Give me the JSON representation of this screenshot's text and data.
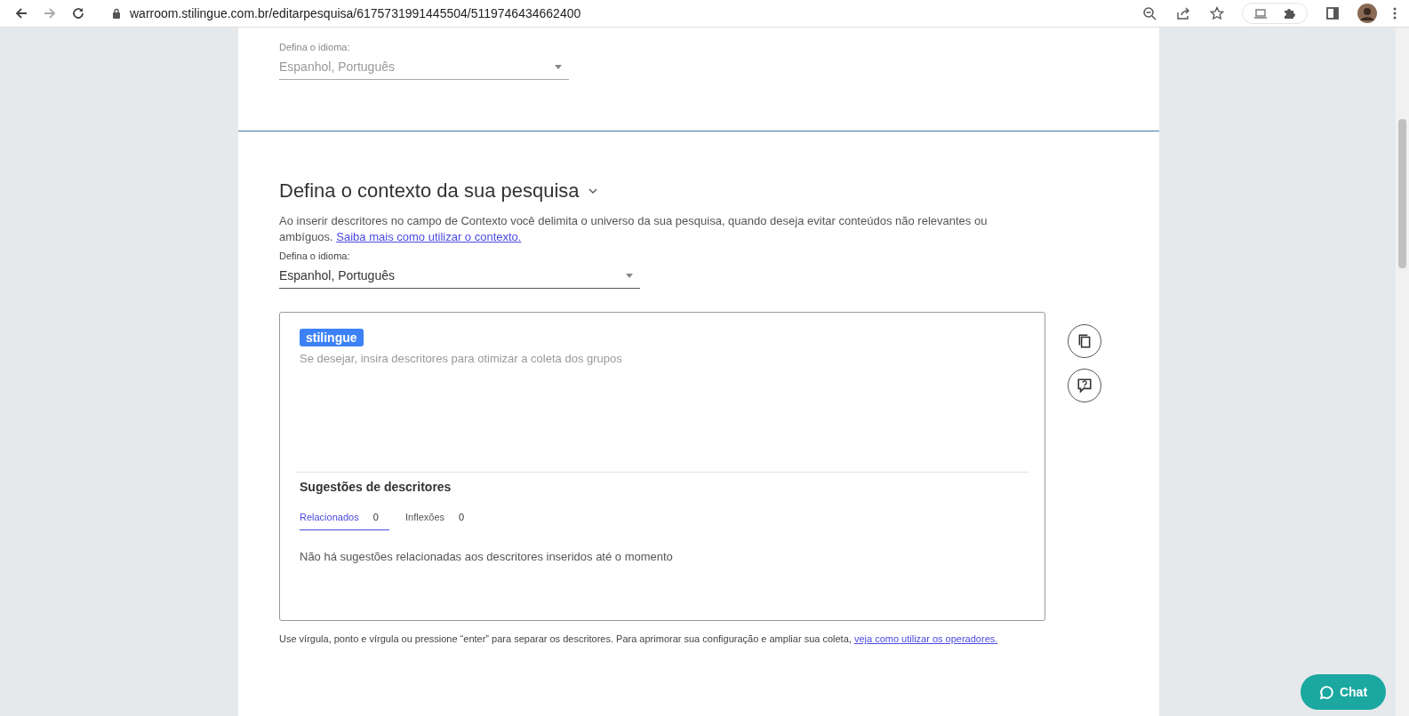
{
  "browser": {
    "url": "warroom.stilingue.com.br/editarpesquisa/6175731991445504/5119746434662400"
  },
  "language_section": {
    "label": "Defina o idioma:",
    "value": "Espanhol, Português",
    "disabled": true
  },
  "context_section": {
    "title": "Defina o contexto da sua pesquisa",
    "description": "Ao inserir descritores no campo de Contexto você delimita o universo da sua pesquisa, quando deseja evitar conteúdos não relevantes ou ambíguos.",
    "link": "Saiba mais como utilizar o contexto.",
    "language": {
      "label": "Defina o idioma:",
      "value": "Espanhol, Português",
      "disabled": false
    },
    "editor": {
      "tags": [
        {
          "label": "stilingue"
        }
      ],
      "placeholder": "Se desejar, insira descritores para otimizar a coleta dos grupos",
      "suggestions": {
        "title": "Sugestões de descritores",
        "tabs": [
          {
            "label": "Relacionados",
            "count": "0",
            "selected": true
          },
          {
            "label": "Inflexões",
            "count": "0",
            "selected": false
          }
        ],
        "empty_message": "Não há sugestões relacionadas aos descritores inseridos até o momento"
      }
    },
    "help_text": "Use vírgula, ponto e vírgula ou pressione “enter” para separar os descritores. Para aprimorar sua configuração e ampliar sua coleta,",
    "help_link": "veja como utilizar os operadores."
  },
  "chat_button": {
    "label": "Chat"
  }
}
